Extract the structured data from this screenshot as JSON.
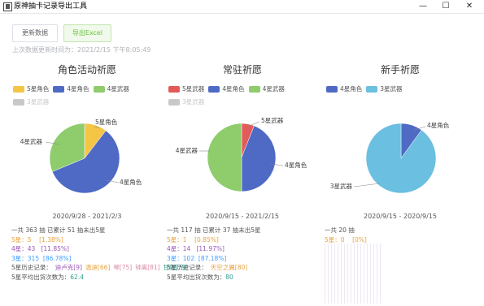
{
  "window": {
    "title": "原神抽卡记录导出工具",
    "controls": [
      "—",
      "☐",
      "✕"
    ]
  },
  "toolbar": {
    "refresh_label": "更新数据",
    "export_label": "导出Excel",
    "last_update": "上次数据更新时间为：2021/2/15 下午8:05:49"
  },
  "colors": {
    "five_char": "#f5c545",
    "four_char": "#4f6ac5",
    "four_weapon": "#8fcc6c",
    "five_weapon": "#e25a5a",
    "three_weapon": "#6bbfe0",
    "disabled": "#c8c8c8"
  },
  "panels": [
    {
      "title": "角色活动祈愿",
      "legend": [
        {
          "label": "5星角色",
          "color": "#f5c545",
          "enabled": true
        },
        {
          "label": "4星角色",
          "color": "#4f6ac5",
          "enabled": true
        },
        {
          "label": "4星武器",
          "color": "#8fcc6c",
          "enabled": true
        },
        {
          "label": "3星武器",
          "color": "#c8c8c8",
          "enabled": false
        }
      ],
      "chart_data": {
        "type": "pie",
        "slices": [
          {
            "name": "5星角色",
            "value": 5,
            "color": "#f5c545"
          },
          {
            "name": "4星角色",
            "value": 28,
            "color": "#4f6ac5"
          },
          {
            "name": "4星武器",
            "value": 15,
            "color": "#8fcc6c"
          }
        ],
        "labels": [
          "5星角色",
          "4星角色",
          "4星武器"
        ]
      },
      "date_range": "2020/9/28   -   2021/2/3",
      "total_line": "一共 363 抽 已累计 51 抽未出5星",
      "stat5": {
        "label": "5星：",
        "count": "5",
        "pct": "[1.38%]"
      },
      "stat4": {
        "label": "4星：",
        "count": "43",
        "pct": "[11.85%]"
      },
      "stat3": {
        "label": "3星：",
        "count": "315",
        "pct": "[86.78%]"
      },
      "history_label": "5星历史记录：",
      "history": [
        {
          "text": "迪卢克[9]",
          "cls": "c-purple"
        },
        {
          "text": "温迪[66]",
          "cls": "c-gold"
        },
        {
          "text": "琴[75]",
          "cls": "c-pink"
        },
        {
          "text": "钟离[81]",
          "cls": "c-pink"
        },
        {
          "text": "甘雨[79]",
          "cls": "c-green"
        }
      ],
      "avg_label": "5星平均出货次数为：",
      "avg_value": "62.4"
    },
    {
      "title": "常驻祈愿",
      "legend": [
        {
          "label": "5星武器",
          "color": "#e25a5a",
          "enabled": true
        },
        {
          "label": "4星角色",
          "color": "#4f6ac5",
          "enabled": true
        },
        {
          "label": "4星武器",
          "color": "#8fcc6c",
          "enabled": true
        },
        {
          "label": "3星武器",
          "color": "#c8c8c8",
          "enabled": false
        }
      ],
      "chart_data": {
        "type": "pie",
        "slices": [
          {
            "name": "5星武器",
            "value": 6,
            "color": "#e25a5a"
          },
          {
            "name": "4星角色",
            "value": 44,
            "color": "#4f6ac5"
          },
          {
            "name": "4星武器",
            "value": 50,
            "color": "#8fcc6c"
          }
        ],
        "labels": [
          "5星武器",
          "4星角色",
          "4星武器"
        ]
      },
      "date_range": "2020/9/15   -   2021/2/15",
      "total_line": "一共 117 抽 已累计 37 抽未出5星",
      "stat5": {
        "label": "5星：",
        "count": "1",
        "pct": "[0.85%]"
      },
      "stat4": {
        "label": "4星：",
        "count": "14",
        "pct": "[11.97%]"
      },
      "stat3": {
        "label": "3星：",
        "count": "102",
        "pct": "[87.18%]"
      },
      "history_label": "5星历史记录：",
      "history": [
        {
          "text": "天空之翼[80]",
          "cls": "c-gold"
        }
      ],
      "avg_label": "5星平均出货次数为：",
      "avg_value": "80"
    },
    {
      "title": "新手祈愿",
      "legend": [
        {
          "label": "4星角色",
          "color": "#4f6ac5",
          "enabled": true
        },
        {
          "label": "3星武器",
          "color": "#6bbfe0",
          "enabled": true
        }
      ],
      "chart_data": {
        "type": "pie",
        "slices": [
          {
            "name": "4星角色",
            "value": 2,
            "color": "#4f6ac5"
          },
          {
            "name": "3星武器",
            "value": 18,
            "color": "#6bbfe0"
          }
        ],
        "labels": [
          "4星角色",
          "3星武器"
        ]
      },
      "date_range": "2020/9/15   -   2020/9/15",
      "total_line": "一共 20 抽",
      "stat5": {
        "label": "5星：",
        "count": "0",
        "pct": "[0%]"
      }
    }
  ]
}
